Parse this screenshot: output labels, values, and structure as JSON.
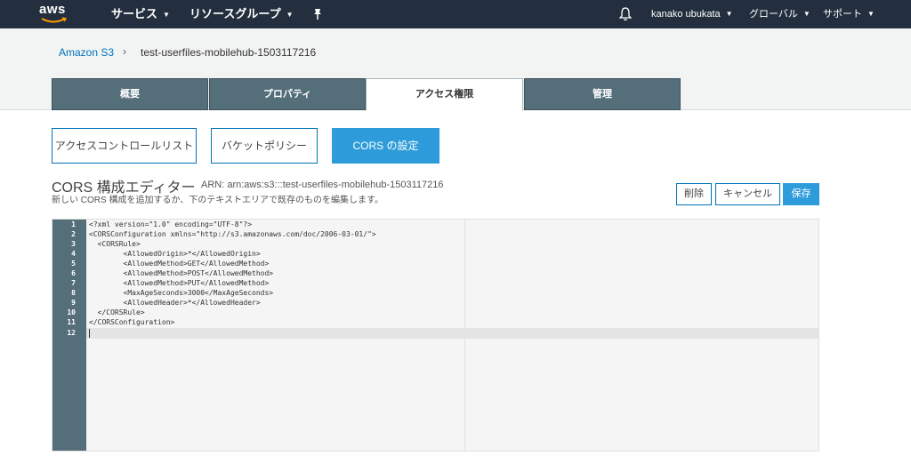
{
  "topnav": {
    "logo": "aws",
    "services": "サービス",
    "resource_groups": "リソースグループ",
    "user": "kanako ubukata",
    "region": "グローバル",
    "support": "サポート",
    "caret": "▼"
  },
  "breadcrumb": {
    "root": "Amazon S3",
    "separator": "›",
    "current": "test-userfiles-mobilehub-1503117216"
  },
  "tabs": [
    {
      "label": "概要",
      "active": false
    },
    {
      "label": "プロパティ",
      "active": false
    },
    {
      "label": "アクセス権限",
      "active": true
    },
    {
      "label": "管理",
      "active": false
    }
  ],
  "subtabs": [
    {
      "label": "アクセスコントロールリスト",
      "active": false
    },
    {
      "label": "バケットポリシー",
      "active": false
    },
    {
      "label": "CORS の設定",
      "active": true
    }
  ],
  "editor": {
    "title": "CORS 構成エディター",
    "arn": "ARN: arn:aws:s3:::test-userfiles-mobilehub-1503117216",
    "description": "新しい CORS 構成を追加するか、下のテキストエリアで既存のものを編集します。",
    "delete_label": "削除",
    "cancel_label": "キャンセル",
    "save_label": "保存",
    "line_numbers": [
      "1",
      "2",
      "3",
      "4",
      "5",
      "6",
      "7",
      "8",
      "9",
      "10",
      "11",
      "12"
    ],
    "lines": [
      "<?xml version=\"1.0\" encoding=\"UTF-8\"?>",
      "<CORSConfiguration xmlns=\"http://s3.amazonaws.com/doc/2006-03-01/\">",
      "  <CORSRule>",
      "        <AllowedOrigin>*</AllowedOrigin>",
      "        <AllowedMethod>GET</AllowedMethod>",
      "        <AllowedMethod>POST</AllowedMethod>",
      "        <AllowedMethod>PUT</AllowedMethod>",
      "        <MaxAgeSeconds>3000</MaxAgeSeconds>",
      "        <AllowedHeader>*</AllowedHeader>",
      "  </CORSRule>",
      "</CORSConfiguration>",
      ""
    ]
  },
  "colors": {
    "nav_bg": "#232f3e",
    "tab_bg": "#546e7a",
    "accent": "#2e9cdb",
    "link": "#0073bb"
  }
}
